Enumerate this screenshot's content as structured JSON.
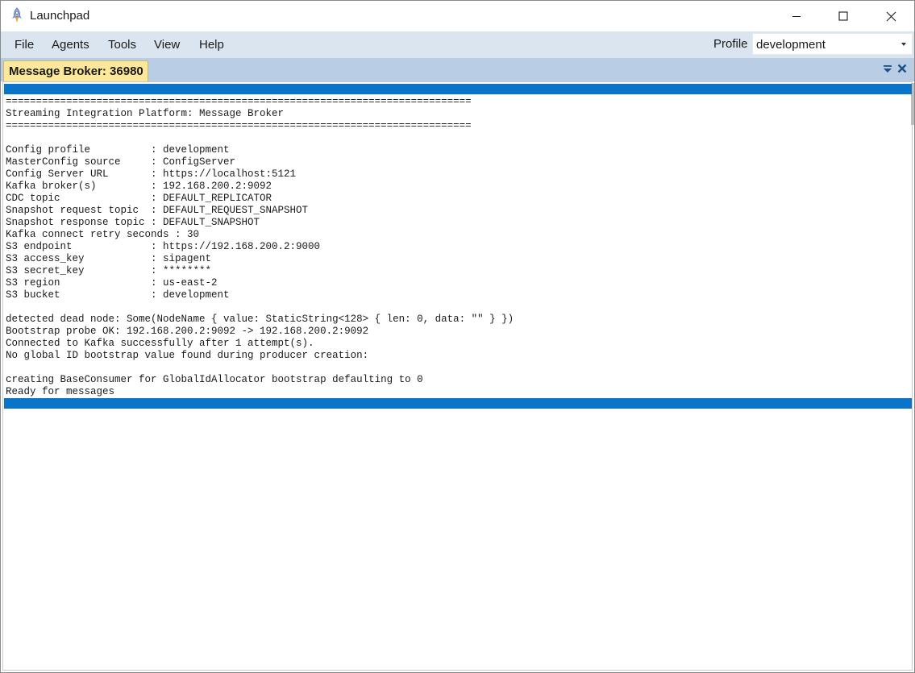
{
  "window": {
    "title": "Launchpad"
  },
  "menu": {
    "items": [
      "File",
      "Agents",
      "Tools",
      "View",
      "Help"
    ],
    "profile_label": "Profile",
    "profile_value": "development"
  },
  "tabs": [
    {
      "label": "Message Broker: 36980"
    }
  ],
  "console": {
    "lines": [
      "=============================================================================",
      "Streaming Integration Platform: Message Broker",
      "=============================================================================",
      "",
      "Config profile          : development",
      "MasterConfig source     : ConfigServer",
      "Config Server URL       : https://localhost:5121",
      "Kafka broker(s)         : 192.168.200.2:9092",
      "CDC topic               : DEFAULT_REPLICATOR",
      "Snapshot request topic  : DEFAULT_REQUEST_SNAPSHOT",
      "Snapshot response topic : DEFAULT_SNAPSHOT",
      "Kafka connect retry seconds : 30",
      "S3 endpoint             : https://192.168.200.2:9000",
      "S3 access_key           : sipagent",
      "S3 secret_key           : ********",
      "S3 region               : us-east-2",
      "S3 bucket               : development",
      "",
      "detected dead node: Some(NodeName { value: StaticString<128> { len: 0, data: \"\" } })",
      "Bootstrap probe OK: 192.168.200.2:9092 -> 192.168.200.2:9092",
      "Connected to Kafka successfully after 1 attempt(s).",
      "No global ID bootstrap value found during producer creation:",
      "",
      "creating BaseConsumer for GlobalIdAllocator bootstrap defaulting to 0",
      "Ready for messages"
    ]
  },
  "colors": {
    "menubar_bg": "#dbe5f0",
    "tabstrip_bg": "#b9cde4",
    "active_tab_bg": "#fbe89b",
    "highlight_bar": "#0a74c9"
  },
  "icons": {
    "app": "rocket-icon",
    "minimize": "minimize-icon",
    "maximize": "maximize-icon",
    "close": "close-icon",
    "tab_menu": "tab-menu-icon",
    "tab_close": "tab-close-icon"
  }
}
